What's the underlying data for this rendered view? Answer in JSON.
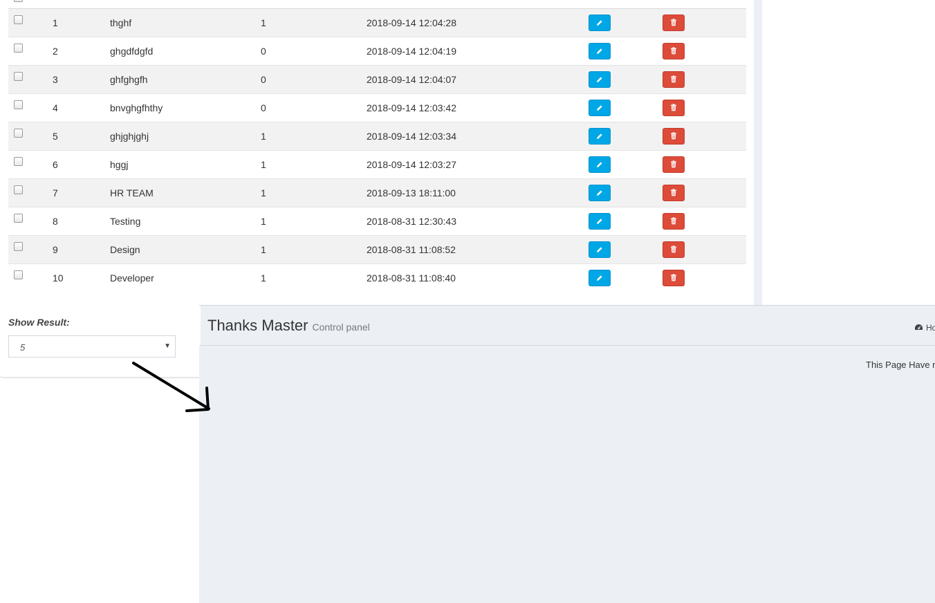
{
  "table": {
    "rows": [
      {
        "num": "1",
        "name": "thghf",
        "status": "1",
        "date": "2018-09-14 12:04:28"
      },
      {
        "num": "2",
        "name": "ghgdfdgfd",
        "status": "0",
        "date": "2018-09-14 12:04:19"
      },
      {
        "num": "3",
        "name": "ghfghgfh",
        "status": "0",
        "date": "2018-09-14 12:04:07"
      },
      {
        "num": "4",
        "name": "bnvghgfhthy",
        "status": "0",
        "date": "2018-09-14 12:03:42"
      },
      {
        "num": "5",
        "name": "ghjghjghj",
        "status": "1",
        "date": "2018-09-14 12:03:34"
      },
      {
        "num": "6",
        "name": "hggj",
        "status": "1",
        "date": "2018-09-14 12:03:27"
      },
      {
        "num": "7",
        "name": "HR TEAM",
        "status": "1",
        "date": "2018-09-13 18:11:00"
      },
      {
        "num": "8",
        "name": "Testing",
        "status": "1",
        "date": "2018-08-31 12:30:43"
      },
      {
        "num": "9",
        "name": "Design",
        "status": "1",
        "date": "2018-08-31 11:08:52"
      },
      {
        "num": "10",
        "name": "Developer",
        "status": "1",
        "date": "2018-08-31 11:08:40"
      }
    ],
    "edit_icon": "pencil-icon",
    "delete_icon": "trash-icon",
    "edit_color": "#00a7e6",
    "delete_color": "#dd4b39"
  },
  "show_result": {
    "label": "Show Result:",
    "selected": "5"
  },
  "content": {
    "title": "Thanks Master",
    "subtitle": "Control panel",
    "breadcrumb": "Ho",
    "breadcrumb_icon": "dashboard-icon",
    "notice": "This Page Have no",
    "background": "#ecf0f5"
  }
}
